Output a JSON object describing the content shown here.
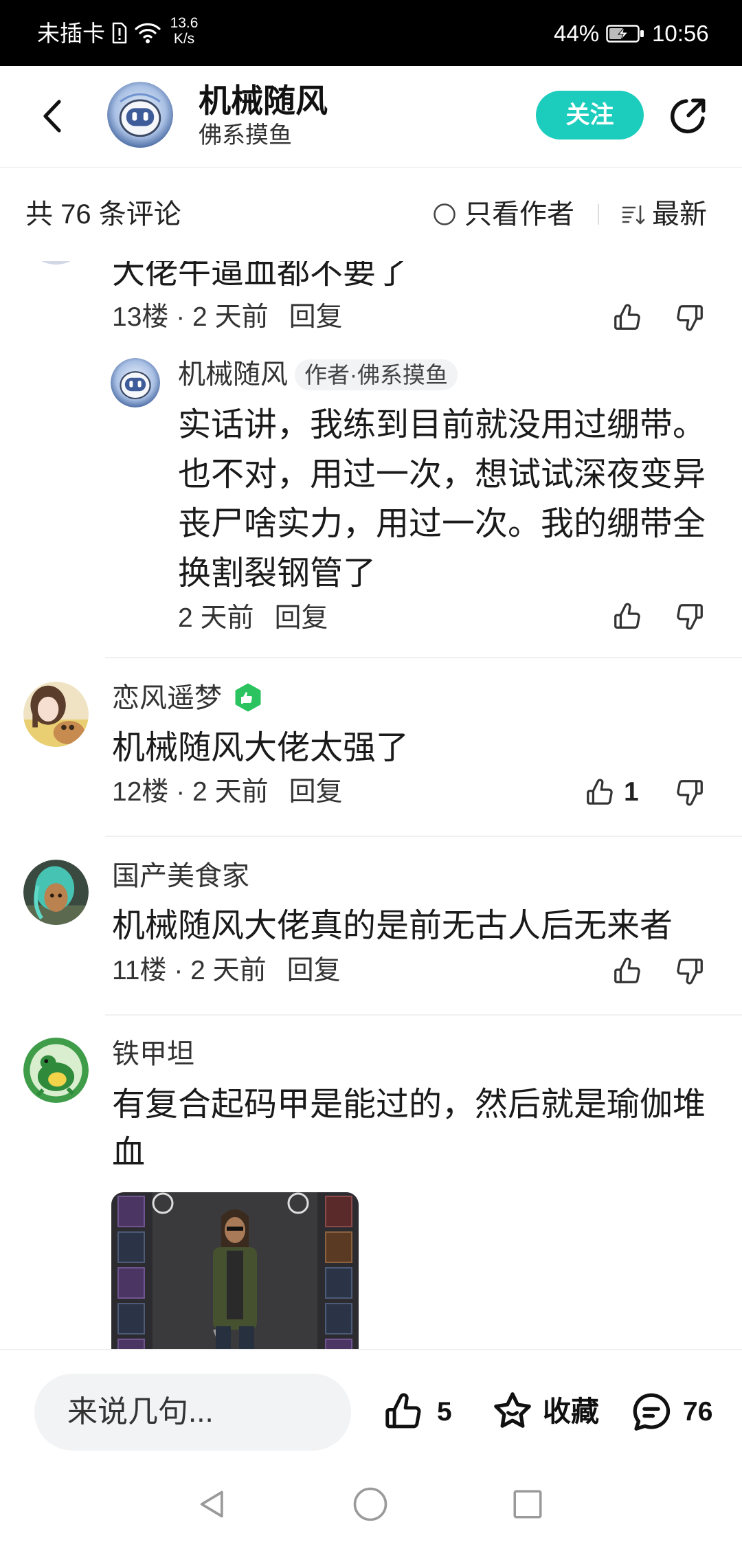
{
  "status_bar": {
    "carrier": "未插卡",
    "net_speed": "13.6",
    "net_speed_unit": "K/s",
    "battery_percent": "44%",
    "time": "10:56",
    "icons": [
      "sim-alert-icon",
      "wifi-icon",
      "battery-charging-icon"
    ]
  },
  "header": {
    "author_name": "机械随风",
    "author_signature": "佛系摸鱼",
    "follow_label": "关注",
    "icons": [
      "back-arrow-icon",
      "share-icon"
    ]
  },
  "comments_bar": {
    "total_label": "共 76 条评论",
    "author_only_label": "只看作者",
    "sort_label": "最新"
  },
  "comments": [
    {
      "text": "大佬牛逼血都不要了",
      "floor_time": "13楼 · 2 天前",
      "reply_label": "回复",
      "author_reply": {
        "name": "机械随风",
        "badge": "作者·佛系摸鱼",
        "text_lines": [
          "实话讲，我练到目前就没用过绷带。",
          "也不对，用过一次，想试试深夜变异",
          "丧尸啥实力，用过一次。我的绷带全",
          "换割裂钢管了"
        ],
        "time": "2 天前",
        "reply_label": "回复"
      }
    },
    {
      "name": "恋风遥梦",
      "text": "机械随风大佬太强了",
      "floor_time": "12楼 · 2 天前",
      "reply_label": "回复",
      "like_count": "1"
    },
    {
      "name": "国产美食家",
      "text": "机械随风大佬真的是前无古人后无来者",
      "floor_time": "11楼 · 2 天前",
      "reply_label": "回复"
    },
    {
      "name": "铁甲坦",
      "text_lines": [
        "有复合起码甲是能过的，然后就是瑜伽堆",
        "血"
      ]
    }
  ],
  "bottom_bar": {
    "input_placeholder": "来说几句...",
    "like_count": "5",
    "favorite_label": "收藏",
    "comment_count": "76"
  },
  "colors": {
    "accent": "#1ccdbd",
    "level_badge": "#2bc35f",
    "status_bar_bg": "#000000"
  }
}
